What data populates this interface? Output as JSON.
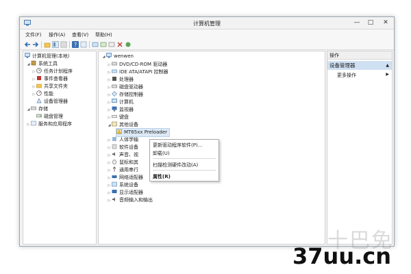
{
  "window": {
    "title": "计算机管理",
    "min": "—",
    "max": "□",
    "close": "✕"
  },
  "menubar": [
    "文件(F)",
    "操作(A)",
    "查看(V)",
    "帮助(H)"
  ],
  "left_tree": {
    "root": "计算机管理(本地)",
    "system_tools": "系统工具",
    "task_scheduler": "任务计划程序",
    "event_viewer": "事件查看器",
    "shared_folders": "共享文件夹",
    "performance": "性能",
    "device_manager": "设备管理器",
    "storage": "存储",
    "disk_management": "磁盘管理",
    "services": "服务和应用程序"
  },
  "device_tree": {
    "root": "wenwen",
    "items": [
      "DVD/CD-ROM 驱动器",
      "IDE ATA/ATAPI 控制器",
      "处理器",
      "磁盘驱动器",
      "存储控制器",
      "计算机",
      "监视器",
      "键盘",
      "其他设备"
    ],
    "child": "MT65xx Preloader",
    "items_after": [
      "人体学输",
      "软件设备",
      "声音、视",
      "鼠标和其",
      "通用串行",
      "网络适配器",
      "系统设备",
      "显示适配器",
      "音频输入和输出"
    ]
  },
  "context_menu": {
    "update": "更新驱动程序软件(P)...",
    "uninstall": "卸载(U)",
    "scan": "扫描检测硬件改动(A)",
    "properties": "属性(R)"
  },
  "actions": {
    "header": "操作",
    "group": "设备管理器",
    "more": "更多操作"
  },
  "watermark": {
    "faded": "十巴免",
    "main": "37uu.cn"
  }
}
